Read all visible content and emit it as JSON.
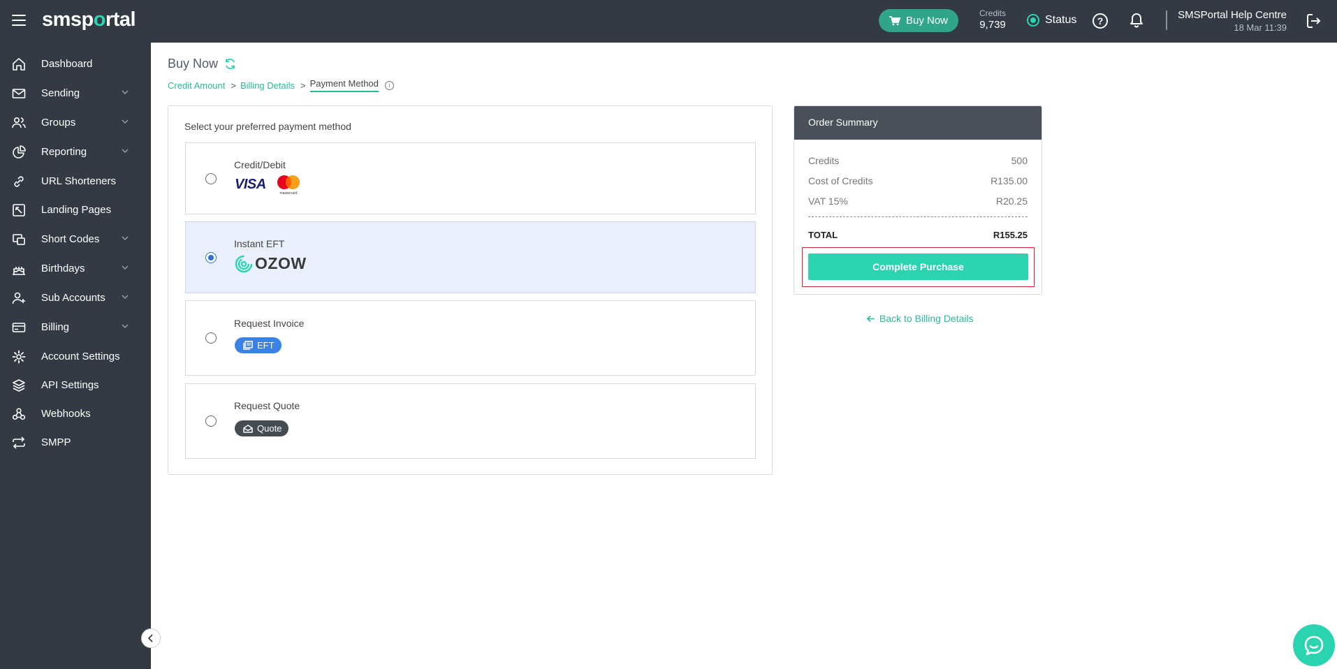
{
  "app": {
    "logo_text_1": "smsp",
    "logo_text_o": "o",
    "logo_text_2": "rtal"
  },
  "topbar": {
    "buy_now": "Buy Now",
    "credits_label": "Credits",
    "credits_value": "9,739",
    "status_label": "Status",
    "user_name": "SMSPortal Help Centre",
    "user_date": "18 Mar 11:39"
  },
  "sidebar": {
    "items": [
      {
        "label": "Dashboard",
        "icon": "home-icon",
        "has_chevron": false
      },
      {
        "label": "Sending",
        "icon": "mail-icon",
        "has_chevron": true
      },
      {
        "label": "Groups",
        "icon": "users-icon",
        "has_chevron": true
      },
      {
        "label": "Reporting",
        "icon": "pie-chart-icon",
        "has_chevron": true
      },
      {
        "label": "URL Shorteners",
        "icon": "link-icon",
        "has_chevron": false
      },
      {
        "label": "Landing Pages",
        "icon": "landing-page-icon",
        "has_chevron": false
      },
      {
        "label": "Short Codes",
        "icon": "short-code-icon",
        "has_chevron": true
      },
      {
        "label": "Birthdays",
        "icon": "cake-icon",
        "has_chevron": true
      },
      {
        "label": "Sub Accounts",
        "icon": "add-user-icon",
        "has_chevron": true
      },
      {
        "label": "Billing",
        "icon": "credit-card-icon",
        "has_chevron": true
      },
      {
        "label": "Account Settings",
        "icon": "gear-icon",
        "has_chevron": false
      },
      {
        "label": "API Settings",
        "icon": "layers-icon",
        "has_chevron": false
      },
      {
        "label": "Webhooks",
        "icon": "webhook-icon",
        "has_chevron": false
      },
      {
        "label": "SMPP",
        "icon": "repeat-icon",
        "has_chevron": false
      }
    ]
  },
  "main": {
    "page_title": "Buy Now",
    "breadcrumb": {
      "step1": "Credit Amount",
      "step2": "Billing Details",
      "step3": "Payment Method",
      "separator": ">"
    },
    "payment": {
      "title": "Select your preferred payment method",
      "options": [
        {
          "label": "Credit/Debit",
          "selected": false,
          "brand": "VISA",
          "brand2": "mastercard"
        },
        {
          "label": "Instant EFT",
          "selected": true,
          "brand": "OZOW"
        },
        {
          "label": "Request Invoice",
          "selected": false,
          "pill": "EFT"
        },
        {
          "label": "Request Quote",
          "selected": false,
          "pill": "Quote"
        }
      ]
    }
  },
  "order_summary": {
    "title": "Order Summary",
    "rows": [
      {
        "label": "Credits",
        "value": "500"
      },
      {
        "label": "Cost of Credits",
        "value": "R135.00"
      },
      {
        "label": "VAT 15%",
        "value": "R20.25"
      }
    ],
    "total_label": "TOTAL",
    "total_value": "R155.25",
    "button": "Complete Purchase",
    "back_link": "Back to Billing Details"
  },
  "colors": {
    "sidebar_bg": "#343a43",
    "accent": "#2bd4b0",
    "accent_text": "#2bb99a",
    "buy_btn": "#2fa589",
    "radio_selected": "#2d6fd8",
    "eft_pill": "#3b82e6",
    "highlight_border": "#e0242e"
  }
}
